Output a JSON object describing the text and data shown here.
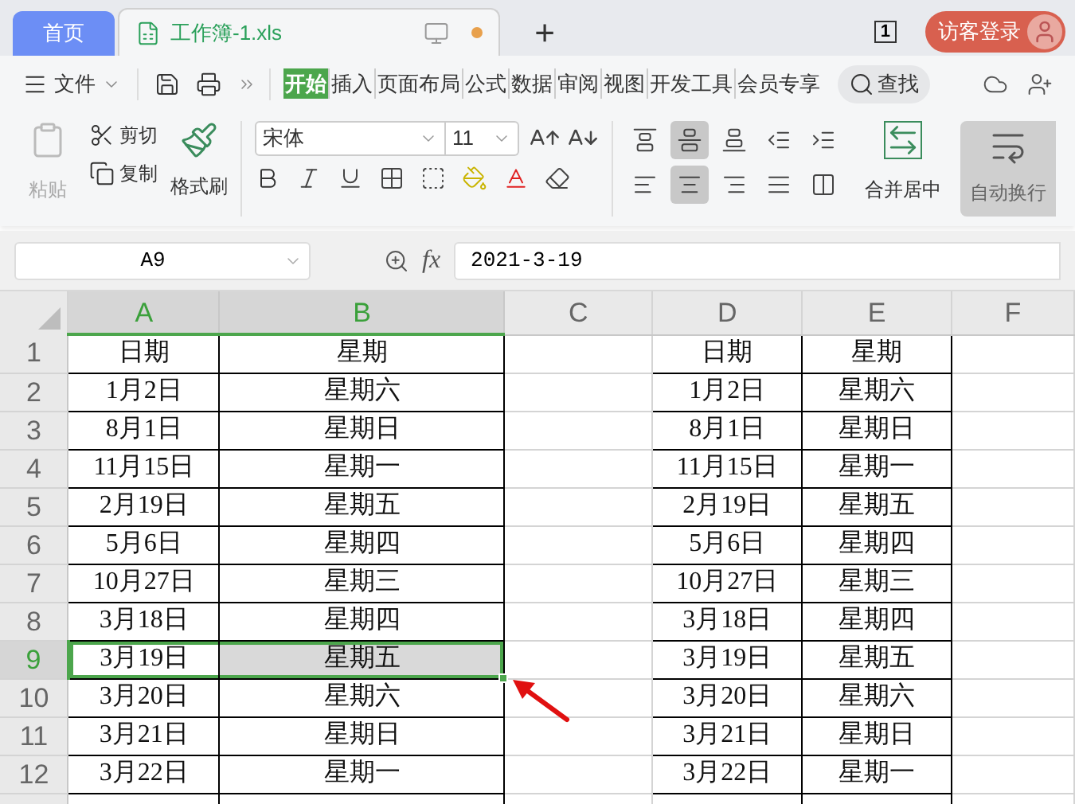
{
  "tabs": [
    {
      "label": "首页",
      "selected": false
    },
    {
      "label": "工作簿-1.xls",
      "selected": true,
      "modified": true
    }
  ],
  "new_tab": "+",
  "window_badge": "1",
  "login": "访客登录",
  "menu": {
    "file": "文件",
    "tabs": [
      {
        "label": "开始",
        "selected": true
      },
      {
        "label": "插入",
        "selected": false
      },
      {
        "label": "页面布局",
        "selected": false
      },
      {
        "label": "公式",
        "selected": false
      },
      {
        "label": "数据",
        "selected": false
      },
      {
        "label": "审阅",
        "selected": false
      },
      {
        "label": "视图",
        "selected": false
      },
      {
        "label": "开发工具",
        "selected": false
      },
      {
        "label": "会员专享",
        "selected": false
      }
    ],
    "search": "查找"
  },
  "ribbon": {
    "paste": "粘贴",
    "cut": "剪切",
    "copy": "复制",
    "format_painter": "格式刷",
    "font": "宋体",
    "size": "11",
    "align_buttons": [
      {
        "kind": "top",
        "selected": false
      },
      {
        "kind": "middle",
        "selected": true
      },
      {
        "kind": "bottom",
        "selected": false
      },
      {
        "kind": "outdent",
        "selected": false
      },
      {
        "kind": "indent",
        "selected": false
      },
      {
        "kind": "left",
        "selected": false
      },
      {
        "kind": "center",
        "selected": true
      },
      {
        "kind": "right",
        "selected": false
      },
      {
        "kind": "justify",
        "selected": false
      },
      {
        "kind": "distribute",
        "selected": false
      }
    ],
    "merge": "合并居中",
    "wrap": {
      "label": "自动换行",
      "selected": true
    }
  },
  "formula_bar": {
    "cell_ref": "A9",
    "fx": "fx",
    "value": "2021-3-19"
  },
  "columns": [
    {
      "label": "A",
      "selected": true,
      "boxed": true
    },
    {
      "label": "B",
      "selected": true,
      "boxed": true
    },
    {
      "label": "C",
      "selected": false,
      "boxed": false
    },
    {
      "label": "D",
      "selected": false,
      "boxed": true
    },
    {
      "label": "E",
      "selected": false,
      "boxed": true
    },
    {
      "label": "F",
      "selected": false,
      "boxed": false
    }
  ],
  "rows": [
    {
      "number": "1",
      "selected": false,
      "cells": [
        "日期",
        "星期",
        "",
        "日期",
        "星期",
        ""
      ]
    },
    {
      "number": "2",
      "selected": false,
      "cells": [
        "1月2日",
        "星期六",
        "",
        "1月2日",
        "星期六",
        ""
      ]
    },
    {
      "number": "3",
      "selected": false,
      "cells": [
        "8月1日",
        "星期日",
        "",
        "8月1日",
        "星期日",
        ""
      ]
    },
    {
      "number": "4",
      "selected": false,
      "cells": [
        "11月15日",
        "星期一",
        "",
        "11月15日",
        "星期一",
        ""
      ]
    },
    {
      "number": "5",
      "selected": false,
      "cells": [
        "2月19日",
        "星期五",
        "",
        "2月19日",
        "星期五",
        ""
      ]
    },
    {
      "number": "6",
      "selected": false,
      "cells": [
        "5月6日",
        "星期四",
        "",
        "5月6日",
        "星期四",
        ""
      ]
    },
    {
      "number": "7",
      "selected": false,
      "cells": [
        "10月27日",
        "星期三",
        "",
        "10月27日",
        "星期三",
        ""
      ]
    },
    {
      "number": "8",
      "selected": false,
      "cells": [
        "3月18日",
        "星期四",
        "",
        "3月18日",
        "星期四",
        ""
      ]
    },
    {
      "number": "9",
      "selected": true,
      "cells": [
        "3月19日",
        "星期五",
        "",
        "3月19日",
        "星期五",
        ""
      ]
    },
    {
      "number": "10",
      "selected": false,
      "cells": [
        "3月20日",
        "星期六",
        "",
        "3月20日",
        "星期六",
        ""
      ]
    },
    {
      "number": "11",
      "selected": false,
      "cells": [
        "3月21日",
        "星期日",
        "",
        "3月21日",
        "星期日",
        ""
      ]
    },
    {
      "number": "12",
      "selected": false,
      "cells": [
        "3月22日",
        "星期一",
        "",
        "3月22日",
        "星期一",
        ""
      ]
    }
  ]
}
